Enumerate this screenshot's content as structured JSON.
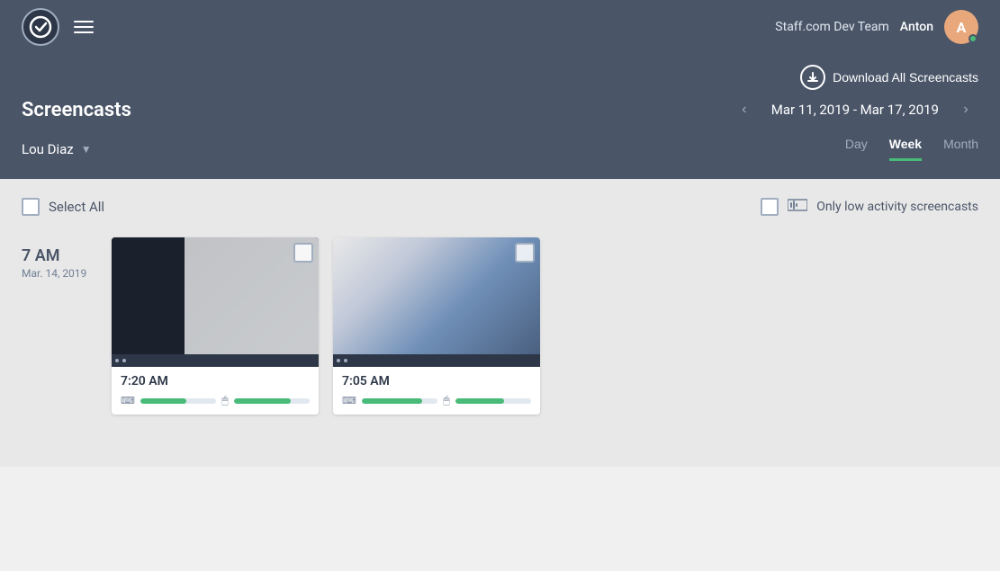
{
  "header": {
    "team_name": "Staff.com Dev Team",
    "user_name": "Anton",
    "avatar_letter": "A"
  },
  "download_section": {
    "button_label": "Download All Screencasts"
  },
  "page": {
    "title": "Screencasts"
  },
  "user_selector": {
    "selected_user": "Lou Diaz"
  },
  "date_nav": {
    "date_range": "Mar 11, 2019 - Mar 17, 2019"
  },
  "view_tabs": {
    "day": "Day",
    "week": "Week",
    "month": "Month",
    "active": "Week"
  },
  "filter_row": {
    "select_all_label": "Select All",
    "low_activity_label": "Only low activity screencasts"
  },
  "screencasts": {
    "time_label": "7 AM",
    "date_label": "Mar. 14, 2019",
    "items": [
      {
        "time": "7:20 AM",
        "keyboard_activity": 60,
        "mouse_activity": 75
      },
      {
        "time": "7:05 AM",
        "keyboard_activity": 80,
        "mouse_activity": 65
      }
    ]
  }
}
